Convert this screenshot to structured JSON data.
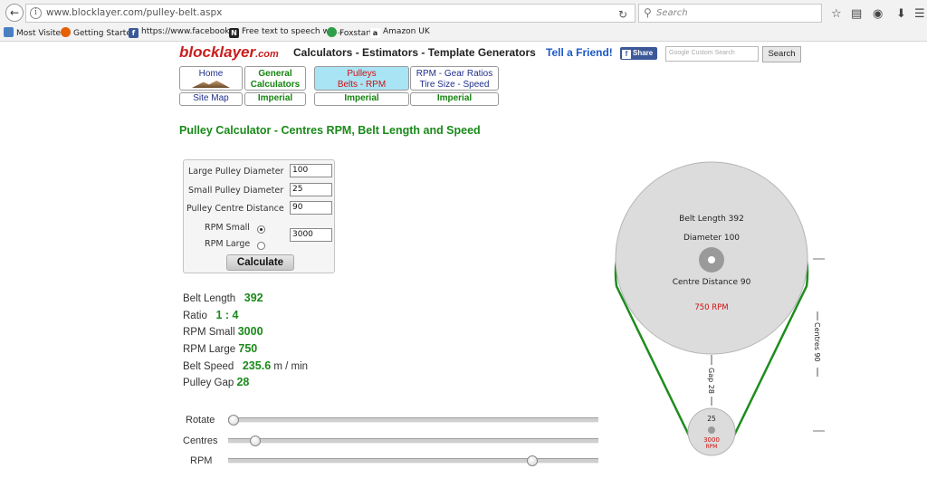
{
  "browser": {
    "url": "www.blocklayer.com/pulley-belt.aspx",
    "search_placeholder": "Search",
    "bookmarks": [
      "Most Visited",
      "Getting Started",
      "https://www.facebook....",
      "Free text to speech wit...",
      "Foxstart",
      "Amazon UK"
    ]
  },
  "site": {
    "logo_main": "blocklayer",
    "logo_suffix": ".com",
    "tagline": "Calculators - Estimators - Template Generators",
    "tell_friend": "Tell a Friend!",
    "fb_share": "Share",
    "search_placeholder": "Google Custom Search",
    "search_button": "Search"
  },
  "nav": {
    "home": "Home",
    "general_line1": "General",
    "general_line2": "Calculators",
    "pulleys_line1": "Pulleys",
    "pulleys_line2": "Belts - RPM",
    "rpm_line1": "RPM - Gear Ratios",
    "rpm_line2": "Tire Size - Speed",
    "site_map": "Site Map",
    "imperial": "Imperial"
  },
  "page": {
    "title": "Pulley Calculator - Centres RPM, Belt Length and Speed"
  },
  "form": {
    "large_label": "Large Pulley Diameter",
    "large_value": "100",
    "small_label": "Small Pulley Diameter",
    "small_value": "25",
    "centre_label": "Pulley Centre Distance",
    "centre_value": "90",
    "rpm_small_label": "RPM Small",
    "rpm_large_label": "RPM Large",
    "rpm_value": "3000",
    "rpm_selected": "small",
    "calculate": "Calculate"
  },
  "results": {
    "belt_length_label": "Belt Length",
    "belt_length": "392",
    "ratio_label": "Ratio",
    "ratio": "1 : 4",
    "rpm_small_label": "RPM Small",
    "rpm_small": "3000",
    "rpm_large_label": "RPM Large",
    "rpm_large": "750",
    "belt_speed_label": "Belt Speed",
    "belt_speed": "235.6",
    "belt_speed_unit": "m / min",
    "gap_label": "Pulley Gap",
    "gap": "28"
  },
  "sliders": {
    "rotate_label": "Rotate",
    "rotate_level": 0.0,
    "centres_label": "Centres",
    "centres_level": 0.06,
    "rpm_label": "RPM",
    "rpm_level": 0.83
  },
  "diagram": {
    "belt_length": "Belt Length 392",
    "diameter": "Diameter 100",
    "centre_distance": "Centre Distance 90",
    "large_rpm": "750 RPM",
    "gap": "Gap  28",
    "centres": "Centres 90",
    "small_diameter": "25",
    "small_rpm": "3000",
    "small_rpm_unit": "RPM",
    "belt_color": "#1e8c1e",
    "rpm_color": "#d01010"
  }
}
